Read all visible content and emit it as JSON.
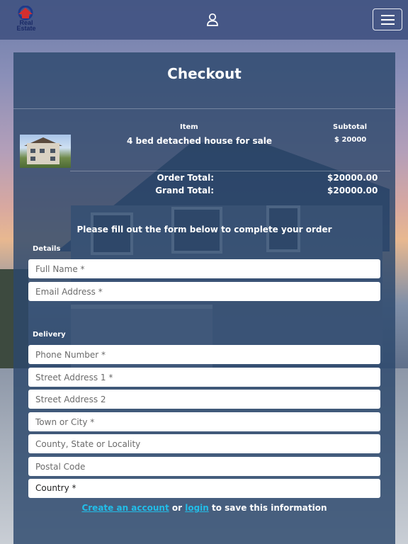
{
  "header": {
    "logo_text_line1": "Real",
    "logo_text_line2": "Estate",
    "logo_icon": "house-logo-icon",
    "user_icon": "user-icon",
    "menu_icon": "hamburger-menu-icon"
  },
  "checkout": {
    "title": "Checkout",
    "table": {
      "item_header": "Item",
      "subtotal_header": "Subtotal",
      "rows": [
        {
          "name": "4 bed detached house for sale",
          "subtotal": "$ 20000"
        }
      ]
    },
    "totals": {
      "order_total_label": "Order Total:",
      "order_total_value": "$20000.00",
      "grand_total_label": "Grand Total:",
      "grand_total_value": "$20000.00"
    },
    "note": "Please fill out the form below to complete your order",
    "details": {
      "label": "Details",
      "full_name_placeholder": "Full Name *",
      "email_placeholder": "Email Address *"
    },
    "delivery": {
      "label": "Delivery",
      "phone_placeholder": "Phone Number *",
      "street1_placeholder": "Street Address 1 *",
      "street2_placeholder": "Street Address 2",
      "town_placeholder": "Town or City *",
      "county_placeholder": "County, State or Locality",
      "postal_placeholder": "Postal Code",
      "country_value": "Country *"
    },
    "footer": {
      "create_account": "Create an account",
      "or": " or ",
      "login": "login",
      "rest": " to save this information"
    }
  },
  "colors": {
    "header_bg": "#425482",
    "panel_bg": "#2c486c",
    "link": "#22bde8"
  }
}
